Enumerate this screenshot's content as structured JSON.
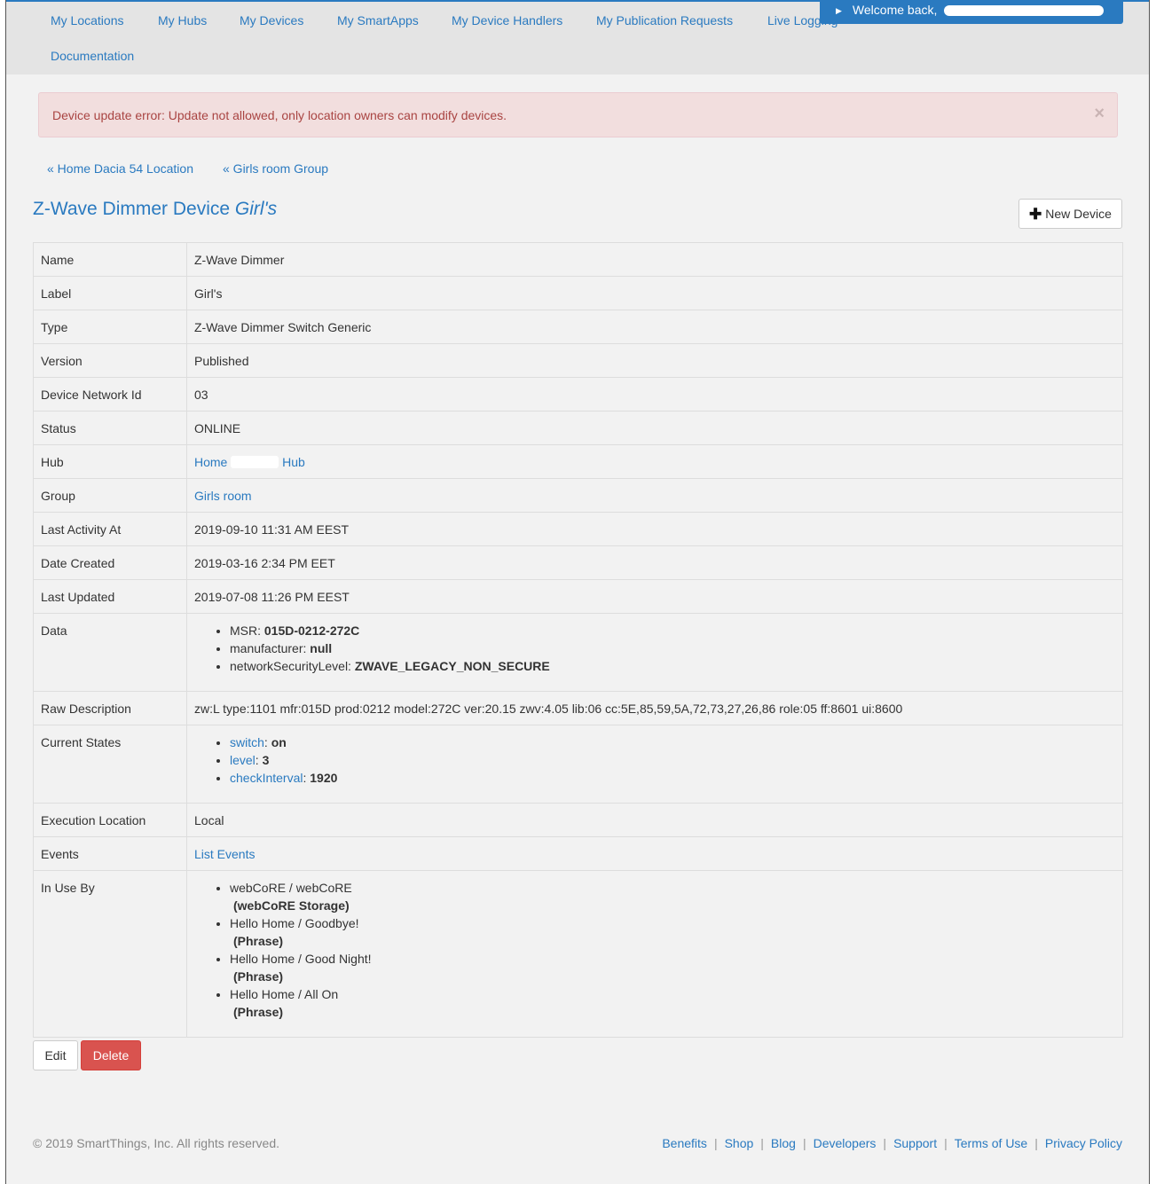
{
  "nav": {
    "items": [
      "My Locations",
      "My Hubs",
      "My Devices",
      "My SmartApps",
      "My Device Handlers",
      "My Publication Requests",
      "Live Logging",
      "Documentation"
    ],
    "welcome": "Welcome back,"
  },
  "alert": {
    "message": "Device update error: Update not allowed, only location owners can modify devices.",
    "close": "×"
  },
  "breadcrumbs": [
    "« Home Dacia 54 Location",
    "« Girls room Group"
  ],
  "title": {
    "prefix": "Z-Wave Dimmer Device",
    "label": "Girl's"
  },
  "new_device_label": "New Device",
  "details": {
    "name": {
      "key": "Name",
      "value": "Z-Wave Dimmer"
    },
    "label": {
      "key": "Label",
      "value": "Girl's"
    },
    "type": {
      "key": "Type",
      "value": "Z-Wave Dimmer Switch Generic"
    },
    "version": {
      "key": "Version",
      "value": "Published"
    },
    "dni": {
      "key": "Device Network Id",
      "value": "03"
    },
    "status": {
      "key": "Status",
      "value": "ONLINE"
    },
    "hub": {
      "key": "Hub",
      "value_start": "Home",
      "value_end": "Hub"
    },
    "group": {
      "key": "Group",
      "value": "Girls room"
    },
    "last_activity": {
      "key": "Last Activity At",
      "value": "2019-09-10 11:31 AM EEST"
    },
    "date_created": {
      "key": "Date Created",
      "value": "2019-03-16 2:34 PM EET"
    },
    "last_updated": {
      "key": "Last Updated",
      "value": "2019-07-08 11:26 PM EEST"
    },
    "data": {
      "key": "Data",
      "items": [
        {
          "name": "MSR:",
          "value": "015D-0212-272C"
        },
        {
          "name": "manufacturer:",
          "value": "null"
        },
        {
          "name": "networkSecurityLevel:",
          "value": "ZWAVE_LEGACY_NON_SECURE"
        }
      ]
    },
    "raw_description": {
      "key": "Raw Description",
      "value": "zw:L type:1101 mfr:015D prod:0212 model:272C ver:20.15 zwv:4.05 lib:06 cc:5E,85,59,5A,72,73,27,26,86 role:05 ff:8601 ui:8600"
    },
    "current_states": {
      "key": "Current States",
      "items": [
        {
          "name": "switch",
          "value": "on"
        },
        {
          "name": "level",
          "value": "3"
        },
        {
          "name": "checkInterval",
          "value": "1920"
        }
      ]
    },
    "execution_location": {
      "key": "Execution Location",
      "value": "Local"
    },
    "events": {
      "key": "Events",
      "value": "List Events"
    },
    "in_use_by": {
      "key": "In Use By",
      "items": [
        {
          "name": "webCoRE / webCoRE",
          "kind": "(webCoRE Storage)"
        },
        {
          "name": "Hello Home / Goodbye!",
          "kind": "(Phrase)"
        },
        {
          "name": "Hello Home / Good Night!",
          "kind": "(Phrase)"
        },
        {
          "name": "Hello Home / All On",
          "kind": "(Phrase)"
        }
      ]
    }
  },
  "actions": {
    "edit": "Edit",
    "delete": "Delete"
  },
  "footer": {
    "copyright": "© 2019 SmartThings, Inc. All rights reserved.",
    "links": [
      "Benefits",
      "Shop",
      "Blog",
      "Developers",
      "Support",
      "Terms of Use",
      "Privacy Policy"
    ],
    "separator": "|"
  }
}
